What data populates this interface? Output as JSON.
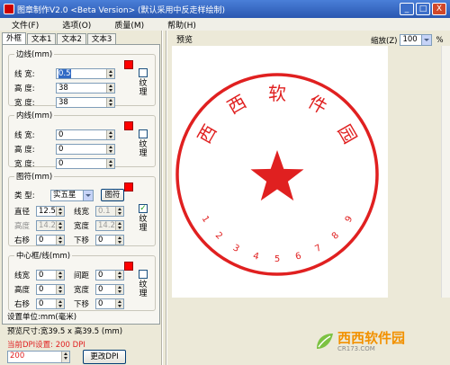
{
  "window": {
    "title": "图章制作V2.0 <Beta Version> (默认采用中反走样绘制)",
    "min": "_",
    "max": "□",
    "close": "X"
  },
  "menu": [
    "文件(F)",
    "选项(O)",
    "质量(M)",
    "帮助(H)"
  ],
  "tabs": [
    "外框",
    "文本1",
    "文本2",
    "文本3"
  ],
  "border_group": {
    "title": "边线(mm)",
    "rows": [
      {
        "label": "线 宽:",
        "value": "0.5"
      },
      {
        "label": "高 度:",
        "value": "38"
      },
      {
        "label": "宽 度:",
        "value": "38"
      }
    ],
    "texture": "纹理"
  },
  "inner_group": {
    "title": "内线(mm)",
    "rows": [
      {
        "label": "线 宽:",
        "value": "0"
      },
      {
        "label": "高 度:",
        "value": "0"
      },
      {
        "label": "宽 度:",
        "value": "0"
      }
    ],
    "texture": "纹理"
  },
  "shape_group": {
    "title": "图符(mm)",
    "type_label": "类 型:",
    "type_value": "实五星",
    "button": "图符",
    "diameter_label": "直径",
    "diameter": "12.5",
    "linewidth_label": "线宽",
    "linewidth": "0.1",
    "height_label": "高度",
    "height": "14.2",
    "width_label": "宽度",
    "width": "14.2",
    "right_label": "右移",
    "right": "0",
    "down_label": "下移",
    "down": "0",
    "texture": "纹理"
  },
  "center_group": {
    "title": "中心框/线(mm)",
    "lw_label": "线宽",
    "lw": "0",
    "gap_label": "间距",
    "gap": "0",
    "h_label": "高度",
    "h": "0",
    "w_label": "宽度",
    "w": "0",
    "r_label": "右移",
    "r": "0",
    "d_label": "下移",
    "d": "0",
    "texture": "纹理"
  },
  "info": {
    "units": "设置单位:mm(毫米)",
    "preview_size": "预览尺寸:宽39.5 x 高39.5 (mm)",
    "dpi_current": "当前DPI设置: 200 DPI",
    "dpi_value": "200",
    "change_dpi": "更改DPI"
  },
  "preview": {
    "label": "预览",
    "zoom_label": "缩放(Z)",
    "zoom_value": "100",
    "zoom_unit": "%"
  },
  "stamp": {
    "color": "#e02020",
    "chars": [
      "西",
      "西",
      "软",
      "件",
      "园"
    ],
    "numbers": [
      "1",
      "2",
      "3",
      "4",
      "5",
      "6",
      "7",
      "8",
      "9"
    ]
  },
  "watermark": {
    "brand": "西西软件园",
    "site": "CR173.COM"
  }
}
